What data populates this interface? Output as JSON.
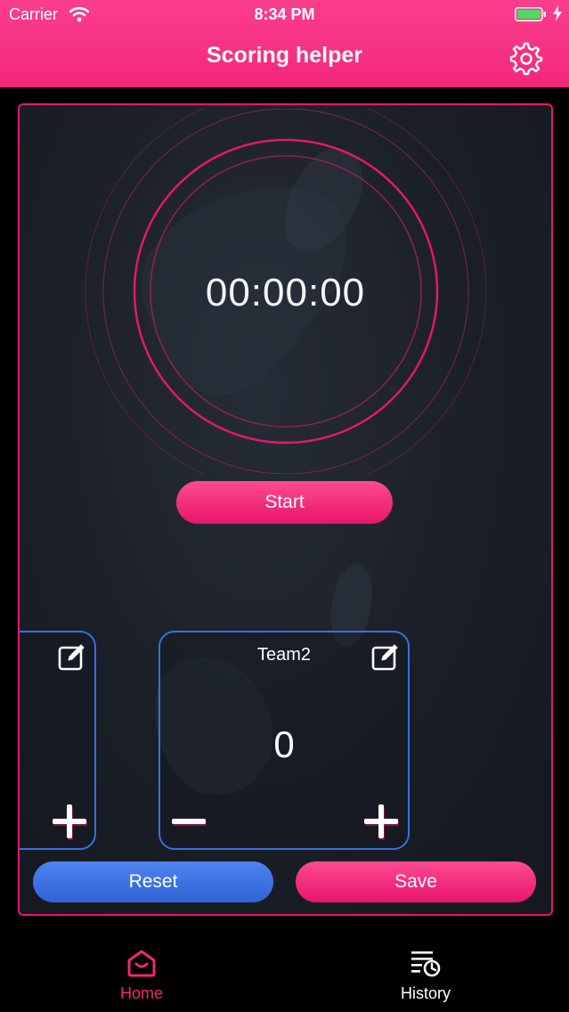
{
  "status_bar": {
    "carrier": "Carrier",
    "time": "8:34 PM"
  },
  "header": {
    "title": "Scoring helper",
    "settings_icon": "gear-icon"
  },
  "timer": {
    "display": "00:00:00"
  },
  "controls": {
    "start_label": "Start",
    "reset_label": "Reset",
    "save_label": "Save"
  },
  "teams": [
    {
      "name": "",
      "score": ""
    },
    {
      "name": "Team2",
      "score": "0"
    }
  ],
  "tabbar": {
    "items": [
      {
        "label": "Home",
        "icon": "home-icon",
        "active": true
      },
      {
        "label": "History",
        "icon": "history-icon",
        "active": false
      }
    ]
  },
  "colors": {
    "accent": "#f0286f",
    "secondary": "#3a6fe0",
    "background": "#1a1e26"
  }
}
